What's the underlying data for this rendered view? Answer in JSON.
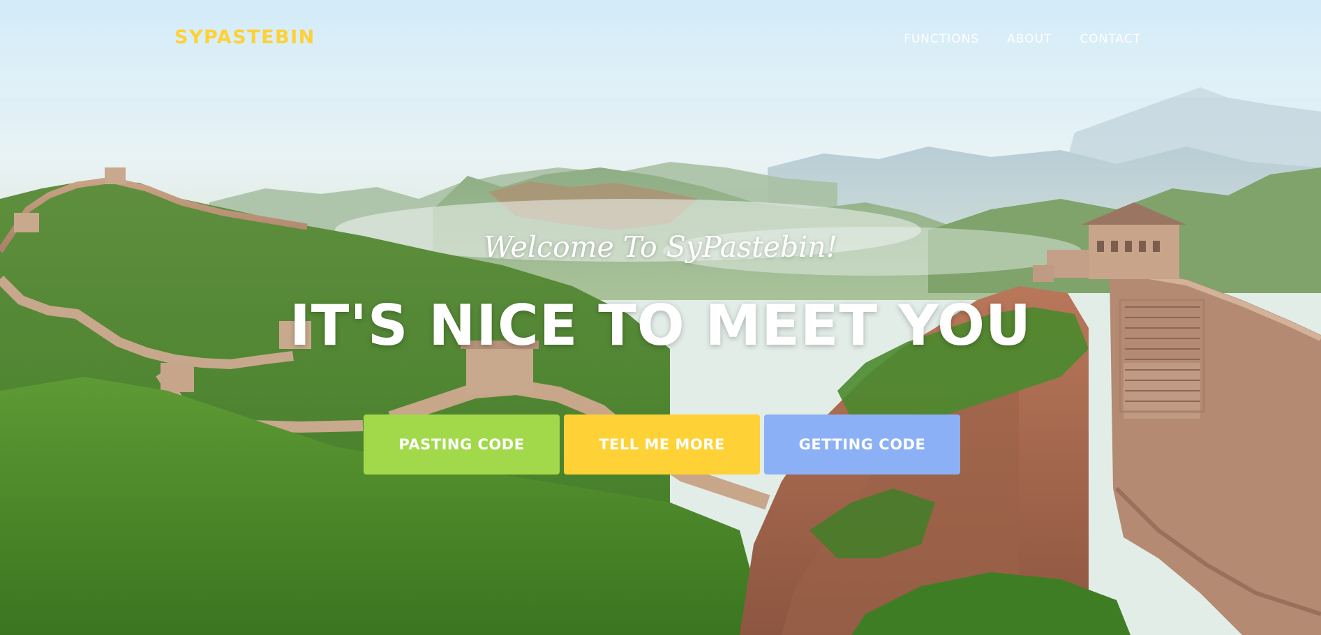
{
  "navbar": {
    "brand": "SYPASTEBIN",
    "links": [
      {
        "label": "FUNCTIONS"
      },
      {
        "label": "ABOUT"
      },
      {
        "label": "CONTACT"
      }
    ]
  },
  "hero": {
    "lead_in": "Welcome To SyPastebin!",
    "heading": "IT'S NICE TO MEET YOU",
    "buttons": [
      {
        "label": "PASTING CODE",
        "color": "#a2d94a"
      },
      {
        "label": "TELL ME MORE",
        "color": "#fed136"
      },
      {
        "label": "GETTING CODE",
        "color": "#8cb0f5"
      }
    ]
  },
  "colors": {
    "brand": "#fed136",
    "text": "#ffffff"
  }
}
